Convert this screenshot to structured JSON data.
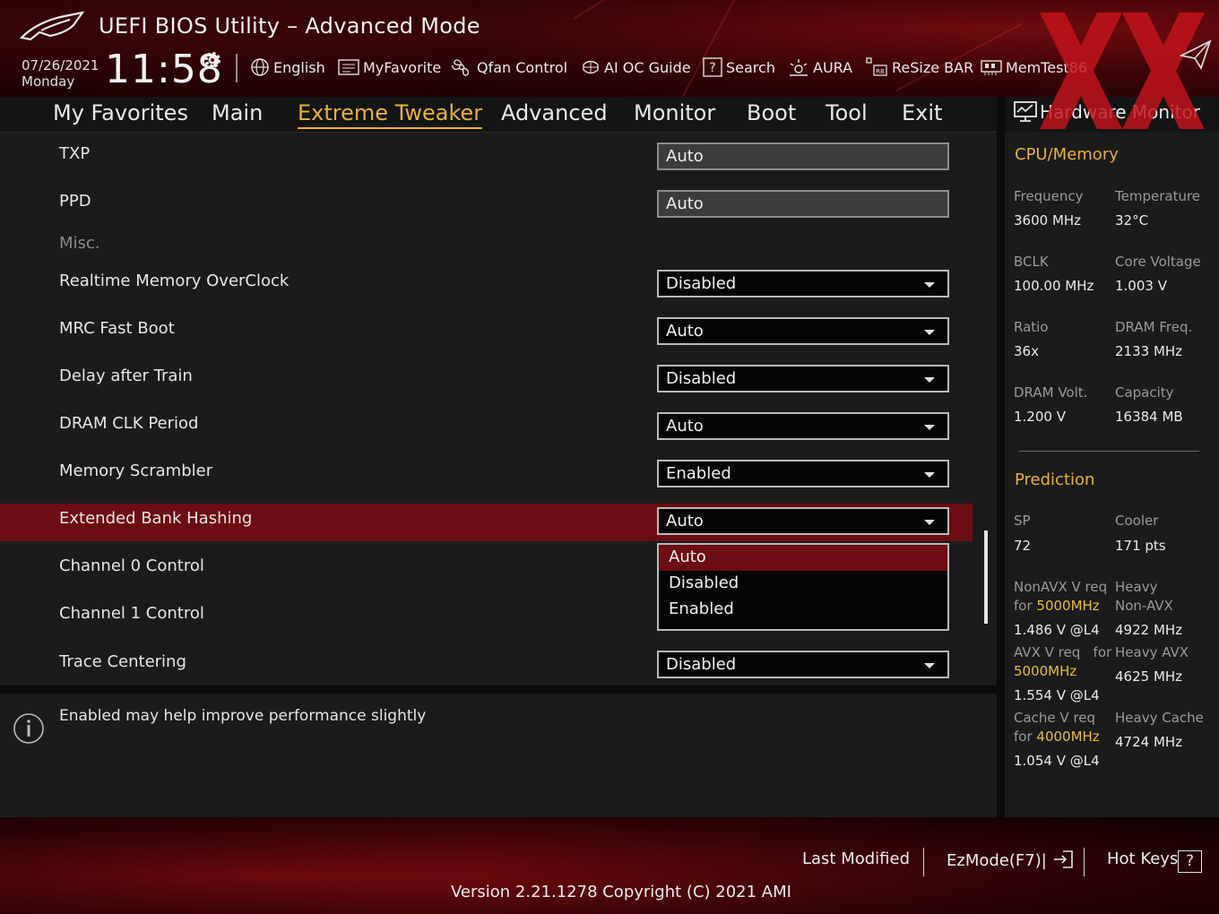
{
  "header": {
    "title": "UEFI BIOS Utility – Advanced Mode",
    "date": "07/26/2021",
    "day": "Monday",
    "time": "11:58",
    "toolbar": [
      {
        "label": "English",
        "icon": "globe-icon"
      },
      {
        "label": "MyFavorite",
        "icon": "favorite-icon"
      },
      {
        "label": "Qfan Control",
        "icon": "fan-icon"
      },
      {
        "label": "AI OC Guide",
        "icon": "ai-chip-icon"
      },
      {
        "label": "Search",
        "icon": "search-help-icon"
      },
      {
        "label": "AURA",
        "icon": "aura-icon"
      },
      {
        "label": "ReSize BAR",
        "icon": "resize-bar-icon"
      },
      {
        "label": "MemTest86",
        "icon": "memtest-icon"
      }
    ]
  },
  "tabs": [
    "My Favorites",
    "Main",
    "Extreme Tweaker",
    "Advanced",
    "Monitor",
    "Boot",
    "Tool",
    "Exit"
  ],
  "active_tab": "Extreme Tweaker",
  "settings": {
    "txp": {
      "label": "TXP",
      "value": "Auto"
    },
    "ppd": {
      "label": "PPD",
      "value": "Auto"
    },
    "misc_section": "Misc.",
    "realtime_oc": {
      "label": "Realtime Memory OverClock",
      "value": "Disabled"
    },
    "mrc_fast_boot": {
      "label": "MRC Fast Boot",
      "value": "Auto"
    },
    "delay_after_train": {
      "label": "Delay after Train",
      "value": "Disabled"
    },
    "dram_clk_period": {
      "label": "DRAM CLK Period",
      "value": "Auto"
    },
    "memory_scrambler": {
      "label": "Memory Scrambler",
      "value": "Enabled"
    },
    "extended_bank_hashing": {
      "label": "Extended Bank Hashing",
      "value": "Auto"
    },
    "channel0": {
      "label": "Channel 0 Control"
    },
    "channel1": {
      "label": "Channel 1 Control"
    },
    "trace_centering": {
      "label": "Trace Centering",
      "value": "Disabled"
    }
  },
  "dropdown_options": [
    "Auto",
    "Disabled",
    "Enabled"
  ],
  "dropdown_highlighted": "Auto",
  "help_text": "Enabled may help improve performance slightly",
  "hw_monitor": {
    "title": "Hardware Monitor",
    "cpu_memory_title": "CPU/Memory",
    "frequency_label": "Frequency",
    "frequency_value": "3600 MHz",
    "temperature_label": "Temperature",
    "temperature_value": "32°C",
    "bclk_label": "BCLK",
    "bclk_value": "100.00 MHz",
    "core_voltage_label": "Core Voltage",
    "core_voltage_value": "1.003 V",
    "ratio_label": "Ratio",
    "ratio_value": "36x",
    "dram_freq_label": "DRAM Freq.",
    "dram_freq_value": "2133 MHz",
    "dram_volt_label": "DRAM Volt.",
    "dram_volt_value": "1.200 V",
    "capacity_label": "Capacity",
    "capacity_value": "16384 MB",
    "prediction_title": "Prediction",
    "sp_label": "SP",
    "sp_value": "72",
    "cooler_label": "Cooler",
    "cooler_value": "171 pts",
    "nonavx_label": "NonAVX V req",
    "nonavx_for": "for",
    "nonavx_freq": "5000MHz",
    "nonavx_value": "1.486 V @L4",
    "heavy_nonavx_label_1": "Heavy",
    "heavy_nonavx_label_2": "Non-AVX",
    "heavy_nonavx_value": "4922 MHz",
    "avx_label": "AVX V req",
    "avx_for": "for",
    "avx_freq": "5000MHz",
    "avx_value": "1.554 V @L4",
    "heavy_avx_label": "Heavy AVX",
    "heavy_avx_value": "4625 MHz",
    "cache_label": "Cache V req",
    "cache_for": "for",
    "cache_freq": "4000MHz",
    "cache_value": "1.054 V @L4",
    "heavy_cache_label": "Heavy Cache",
    "heavy_cache_value": "4724 MHz"
  },
  "footer": {
    "last_modified": "Last Modified",
    "ezmode": "EzMode(F7)|",
    "hot_keys": "Hot Keys",
    "hot_keys_key": "?",
    "version": "Version 2.21.1278 Copyright (C) 2021 AMI"
  },
  "colors": {
    "accent": "#e5b13a",
    "selection": "#6b0d12",
    "brand_red": "#8c0d12",
    "yellow_value": "#e5c030"
  }
}
